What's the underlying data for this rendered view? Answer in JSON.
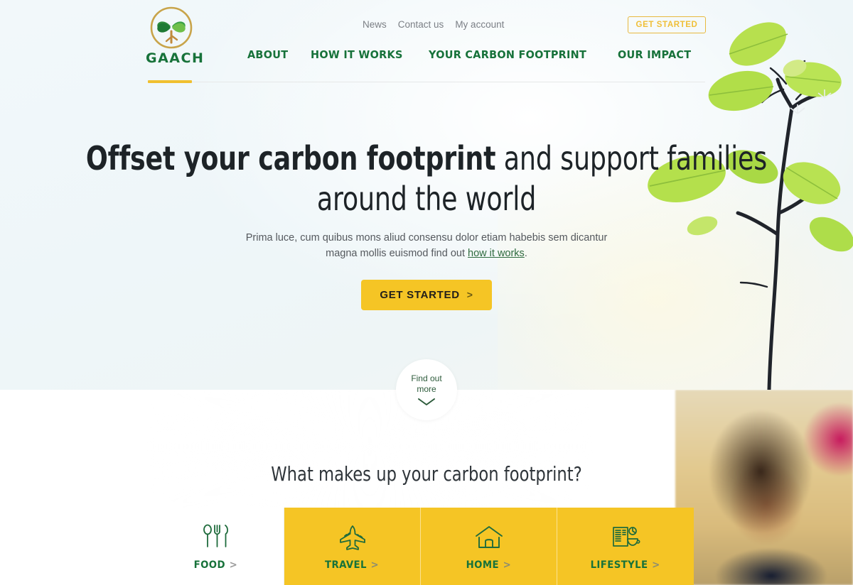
{
  "brand": {
    "name": "GAACH",
    "logo_icon": "clover-logo-icon",
    "ring_color": "#c8a44a",
    "leaf_colors": [
      "#2f8b3d",
      "#3aa148",
      "#6fbf4a",
      "#1f7a35"
    ],
    "text_color": "#17723a"
  },
  "header": {
    "utility_links": [
      {
        "label": "News",
        "name": "news"
      },
      {
        "label": "Contact us",
        "name": "contact-us"
      },
      {
        "label": "My account",
        "name": "my-account"
      }
    ],
    "cta_label": "GET STARTED",
    "nav": [
      {
        "label": "ABOUT",
        "name": "about"
      },
      {
        "label": "HOW IT WORKS",
        "name": "how-it-works"
      },
      {
        "label": "YOUR CARBON FOOTPRINT",
        "name": "your-carbon-footprint"
      },
      {
        "label": "OUR IMPACT",
        "name": "our-impact"
      }
    ],
    "accent_color": "#f0c030",
    "divider_color": "#e6e8e8"
  },
  "hero": {
    "headline_strong": "Offset your carbon footprint",
    "headline_rest": " and support families around the world",
    "subtext_before": "Prima luce, cum quibus mons aliud  consensu dolor etiam habebis sem dicantur magna mollis euismod find out ",
    "subtext_link": "how it works",
    "subtext_after": ".",
    "button_label": "GET STARTED",
    "button_chevron": ">",
    "button_color": "#f5c525",
    "background_color": "#eef6f9",
    "artwork": "leafy-branch-image"
  },
  "scroll_badge": {
    "line1": "Find out",
    "line2": "more",
    "icon": "chevron-down-icon",
    "text_color": "#2d5b3b"
  },
  "footprint_section": {
    "title": "What makes up your carbon footprint?",
    "background_image": "smiling-boy-photo",
    "cards": [
      {
        "label": "FOOD",
        "chevron": ">",
        "icon": "cutlery-icon",
        "active": true
      },
      {
        "label": "TRAVEL",
        "chevron": ">",
        "icon": "airplane-icon",
        "active": false
      },
      {
        "label": "HOME",
        "chevron": ">",
        "icon": "house-icon",
        "active": false
      },
      {
        "label": "LIFESTYLE",
        "chevron": ">",
        "icon": "newspaper-coffee-icon",
        "active": false
      }
    ],
    "card_color": "#f5c525",
    "active_card_color": "#ffffff",
    "label_color": "#17723a"
  }
}
